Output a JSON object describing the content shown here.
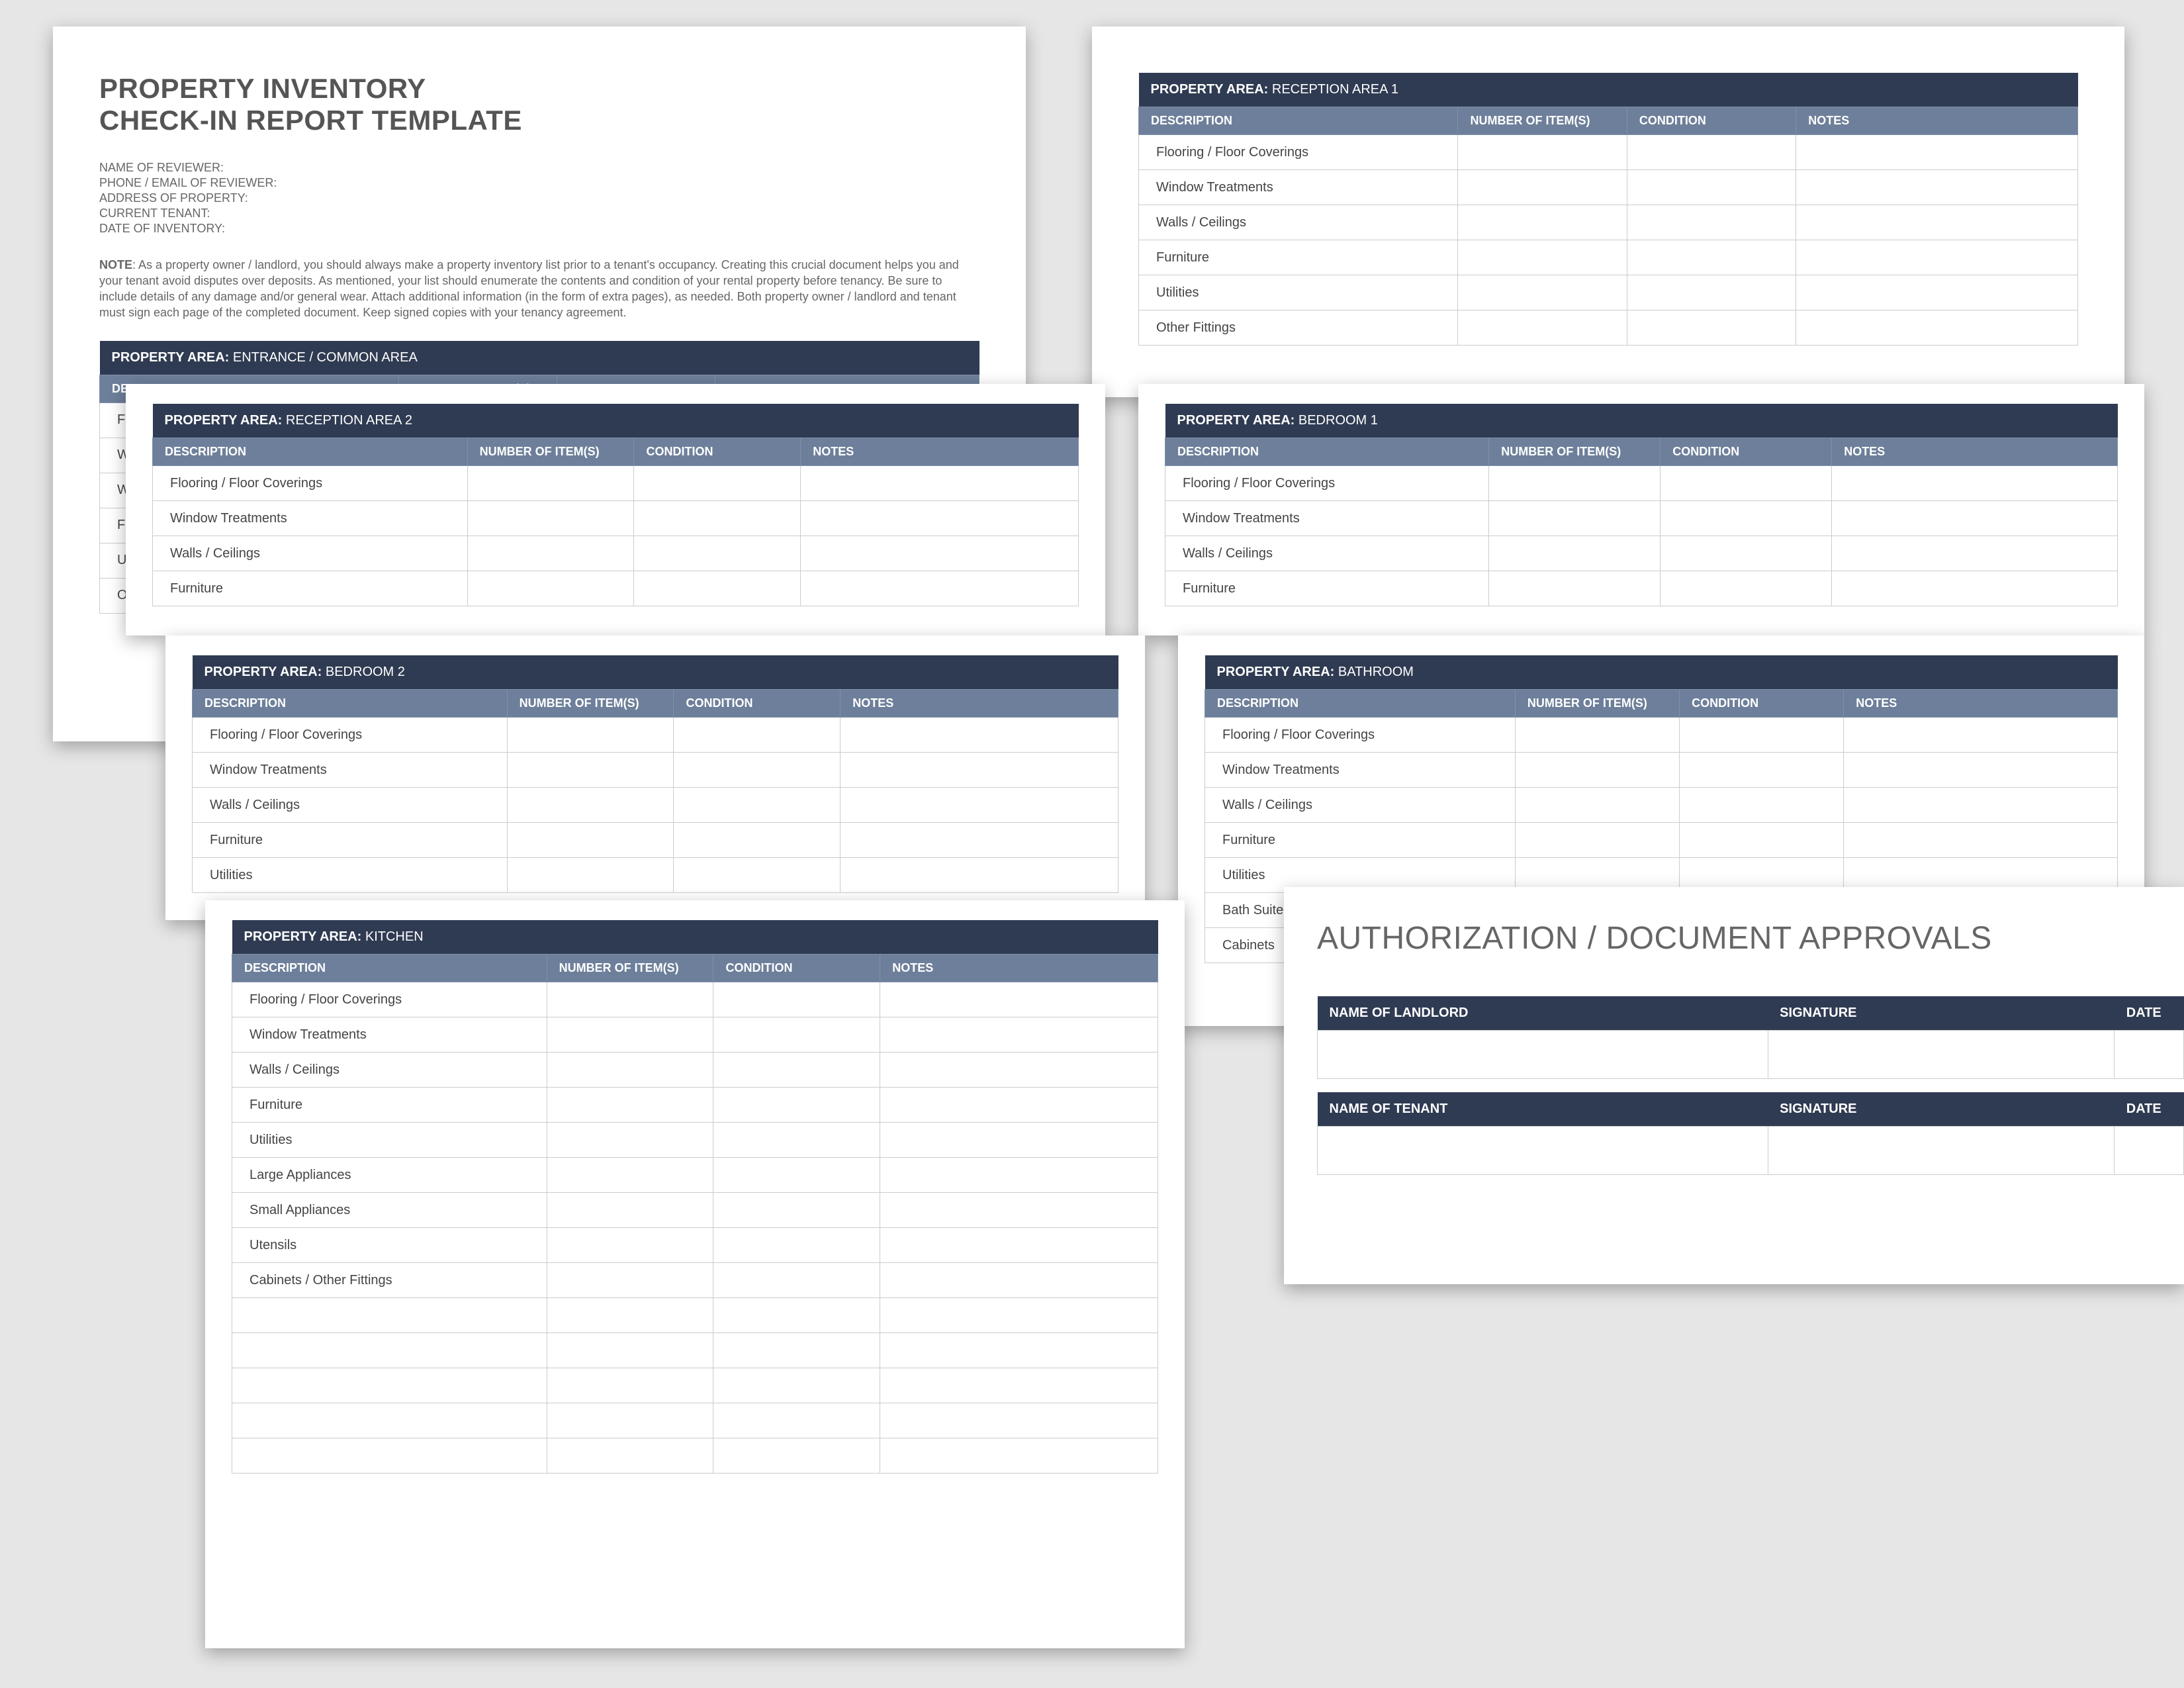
{
  "doc": {
    "title_line1": "PROPERTY INVENTORY",
    "title_line2": "CHECK-IN REPORT TEMPLATE",
    "meta": [
      "NAME OF REVIEWER:",
      "PHONE / EMAIL OF REVIEWER:",
      "ADDRESS OF PROPERTY:",
      "CURRENT TENANT:",
      "DATE OF INVENTORY:"
    ],
    "note_label": "NOTE",
    "note_body": ": As a property owner / landlord, you should always make a property inventory list prior to a tenant's occupancy. Creating this crucial document helps you and your tenant avoid disputes over deposits. As mentioned, your list should enumerate the contents and condition of your rental property before tenancy. Be sure to include details of any damage and/or general wear. Attach additional information (in the form of extra pages), as needed. Both property owner / landlord and tenant must sign each page of the completed document. Keep signed copies with your tenancy agreement."
  },
  "labels": {
    "area_prefix": "PROPERTY AREA:",
    "cols": {
      "desc": "DESCRIPTION",
      "num": "NUMBER OF ITEM(S)",
      "cond": "CONDITION",
      "notes": "NOTES"
    }
  },
  "areas": {
    "entrance": {
      "name": "ENTRANCE / COMMON AREA",
      "rows": [
        "Flooring",
        "Window",
        "Walls /",
        "Furnitu",
        "Utilities",
        "Other"
      ]
    },
    "reception1": {
      "name": "RECEPTION AREA 1",
      "rows": [
        "Flooring / Floor Coverings",
        "Window Treatments",
        "Walls / Ceilings",
        "Furniture",
        "Utilities",
        "Other Fittings"
      ]
    },
    "reception2": {
      "name": "RECEPTION AREA 2",
      "rows": [
        "Flooring / Floor Coverings",
        "Window Treatments",
        "Walls / Ceilings",
        "Furniture"
      ]
    },
    "bedroom1": {
      "name": "BEDROOM 1",
      "rows": [
        "Flooring / Floor Coverings",
        "Window Treatments",
        "Walls / Ceilings",
        "Furniture"
      ]
    },
    "bedroom2": {
      "name": "BEDROOM 2",
      "rows": [
        "Flooring / Floor Coverings",
        "Window Treatments",
        "Walls / Ceilings",
        "Furniture",
        "Utilities"
      ]
    },
    "bathroom": {
      "name": "BATHROOM",
      "rows": [
        "Flooring / Floor Coverings",
        "Window Treatments",
        "Walls / Ceilings",
        "Furniture",
        "Utilities",
        "Bath Suite",
        "Cabinets"
      ]
    },
    "kitchen": {
      "name": "KITCHEN",
      "rows": [
        "Flooring / Floor Coverings",
        "Window Treatments",
        "Walls / Ceilings",
        "Furniture",
        "Utilities",
        "Large Appliances",
        "Small Appliances",
        "Utensils",
        "Cabinets / Other Fittings",
        "",
        "",
        "",
        "",
        ""
      ]
    }
  },
  "auth": {
    "title": "AUTHORIZATION / DOCUMENT APPROVALS",
    "cols": {
      "name_landlord": "NAME OF LANDLORD",
      "name_tenant": "NAME OF TENANT",
      "sig": "SIGNATURE",
      "date": "DATE"
    }
  }
}
